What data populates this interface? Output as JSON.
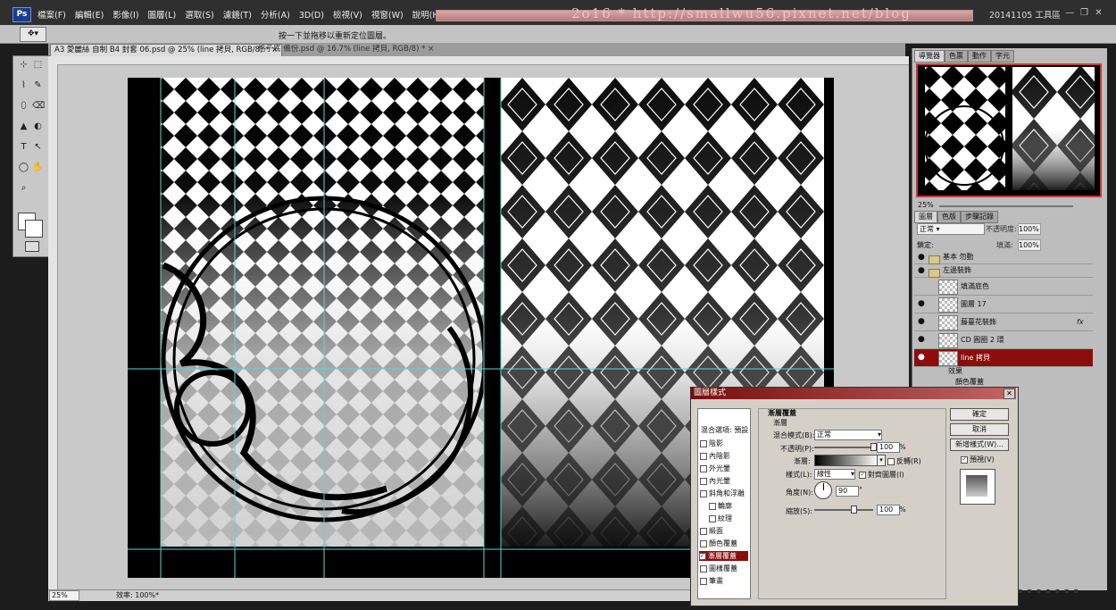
{
  "app": {
    "logo": "Ps",
    "workspace": "20141105 工具區",
    "banner": "2o16 * http://smallwu56.pixnet.net/blog"
  },
  "menu": [
    "檔案(F)",
    "編輯(E)",
    "影像(I)",
    "圖層(L)",
    "選取(S)",
    "濾鏡(T)",
    "分析(A)",
    "3D(D)",
    "檢視(V)",
    "視窗(W)",
    "說明(H)"
  ],
  "window_buttons": {
    "minimize": "—",
    "restore": "❐",
    "close": "✕"
  },
  "options": {
    "hint": "按一下並拖移以重新定位圖層。",
    "tool_icon": "move-tool-icon"
  },
  "tabs": [
    {
      "label": "A3 愛麗絲 自制 B4 封套 06.psd @ 25% (line 拷貝, RGB/8) *",
      "close": "×"
    },
    {
      "label": "格子底 備份.psd @ 16.7% (line 拷貝, RGB/8) *",
      "close": "×"
    }
  ],
  "toolbox": [
    "⊹",
    "⬚",
    "⌇",
    "✎",
    "⬯",
    "⌫",
    "▲",
    "◐",
    "T",
    "↖",
    "◯",
    "✋",
    "⌕"
  ],
  "status": {
    "zoom": "25%",
    "efficiency": "效率: 100%*"
  },
  "navigator": {
    "tabs": [
      "導覽器",
      "色票",
      "動作",
      "字元"
    ],
    "zoom": "25%"
  },
  "layers": {
    "tabs": [
      "圖層",
      "色版",
      "步驟記錄"
    ],
    "blend_mode": "正常",
    "opacity_label": "不透明度:",
    "opacity": "100%",
    "lock_label": "鎖定:",
    "fill_label": "填滿:",
    "fill": "100%",
    "rows": [
      {
        "name": "基本 勿動",
        "folder": true,
        "visible": true
      },
      {
        "name": "左邊裝飾",
        "folder": true,
        "visible": true
      },
      {
        "name": "填滿底色",
        "folder": false,
        "visible": false
      },
      {
        "name": "圖層 17",
        "folder": false,
        "visible": true
      },
      {
        "name": "藤蔓花裝飾",
        "folder": false,
        "visible": true,
        "fx": "fx"
      },
      {
        "name": "CD 圓圈 2 環",
        "folder": false,
        "visible": true
      },
      {
        "name": "line 拷貝",
        "folder": false,
        "visible": true,
        "selected": true
      }
    ],
    "effects_label": "效果",
    "effect_item": "顏色覆蓋"
  },
  "dialog": {
    "title": "圖層樣式",
    "styles_header": "樣式",
    "blend_options": "混合選項: 預設",
    "styles": [
      {
        "label": "陰影",
        "checked": false
      },
      {
        "label": "內陰影",
        "checked": false
      },
      {
        "label": "外光暈",
        "checked": false
      },
      {
        "label": "內光暈",
        "checked": false
      },
      {
        "label": "斜角和浮雕",
        "checked": false
      },
      {
        "label": "輪廓",
        "checked": false,
        "sub": true
      },
      {
        "label": "紋理",
        "checked": false,
        "sub": true
      },
      {
        "label": "緞面",
        "checked": false
      },
      {
        "label": "顏色覆蓋",
        "checked": false
      },
      {
        "label": "漸層覆蓋",
        "checked": true,
        "active": true
      },
      {
        "label": "圖樣覆蓋",
        "checked": false
      },
      {
        "label": "筆畫",
        "checked": false
      }
    ],
    "section_title": "漸層覆蓋",
    "subsection": "漸層",
    "blend_mode_label": "混合模式(B):",
    "blend_mode": "正常",
    "opacity_label": "不透明(P):",
    "opacity": "100",
    "opacity_unit": "%",
    "opacity_level": 1.0,
    "gradient_label": "漸層:",
    "reverse_label": "反轉(R)",
    "style_label": "樣式(L):",
    "style_value": "線性",
    "align_label": "對齊圖層(I)",
    "angle_label": "角度(N):",
    "angle_value": "90",
    "angle_unit": "°",
    "scale_label": "縮放(S):",
    "scale_value": "100",
    "scale_unit": "%",
    "scale_level": 0.66,
    "buttons": {
      "ok": "確定",
      "cancel": "取消",
      "new_style": "新增樣式(W)..."
    },
    "preview_label": "預視(V)"
  },
  "colors": {
    "accent": "#8c0d0d",
    "banner": "#e8c4c4"
  }
}
